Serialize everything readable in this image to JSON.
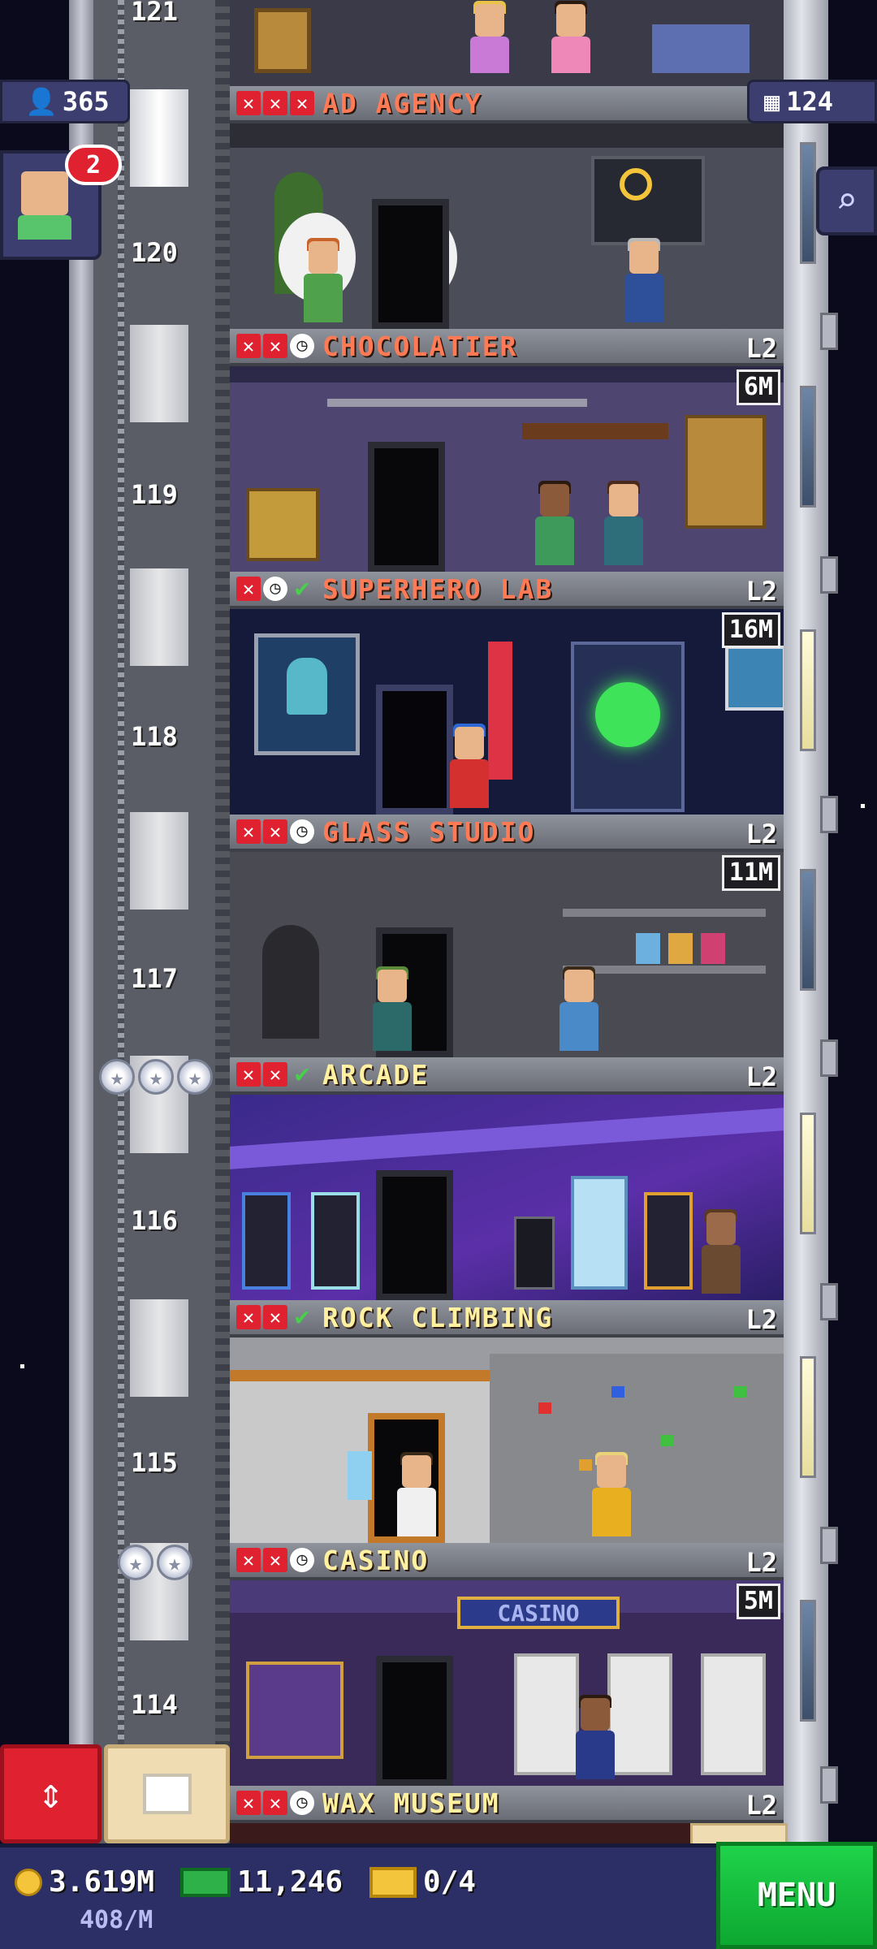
{
  "hud": {
    "population": "365",
    "floor_count": "124",
    "notification_count": "2",
    "search_icon": "magnifier-icon"
  },
  "floors": [
    {
      "number": "121",
      "name": "",
      "level": "",
      "timer": ""
    },
    {
      "number": "120",
      "name": "AD AGENCY",
      "level": "",
      "timer": "",
      "stocked": false
    },
    {
      "number": "119",
      "name": "CHOCOLATIER",
      "level": "L2",
      "timer": "6M",
      "stocked": false
    },
    {
      "number": "118",
      "name": "SUPERHERO LAB",
      "level": "L2",
      "timer": "16M",
      "stocked": false
    },
    {
      "number": "117",
      "name": "GLASS STUDIO",
      "level": "L2",
      "timer": "11M",
      "stocked": false
    },
    {
      "number": "116",
      "name": "ARCADE",
      "level": "L2",
      "timer": "",
      "stocked": true
    },
    {
      "number": "115",
      "name": "ROCK CLIMBING",
      "level": "L2",
      "timer": "",
      "stocked": true
    },
    {
      "number": "114",
      "name": "CASINO",
      "level": "L2",
      "timer": "5M",
      "stocked": true
    },
    {
      "number": "",
      "name": "WAX MUSEUM",
      "level": "L2",
      "timer": "",
      "stocked": false
    }
  ],
  "bottom_bar": {
    "coins": "3.619M",
    "income_rate": "408/M",
    "bux": "11,246",
    "tickets": "0/4",
    "menu_label": "MENU"
  },
  "casino_sign": "CASINO",
  "colors": {
    "accent_red": "#e0212f",
    "menu_green": "#1fd24a",
    "hud_blue": "#3b3e6e",
    "unstocked_text": "#ff7a55",
    "stocked_text": "#fff1a0"
  }
}
